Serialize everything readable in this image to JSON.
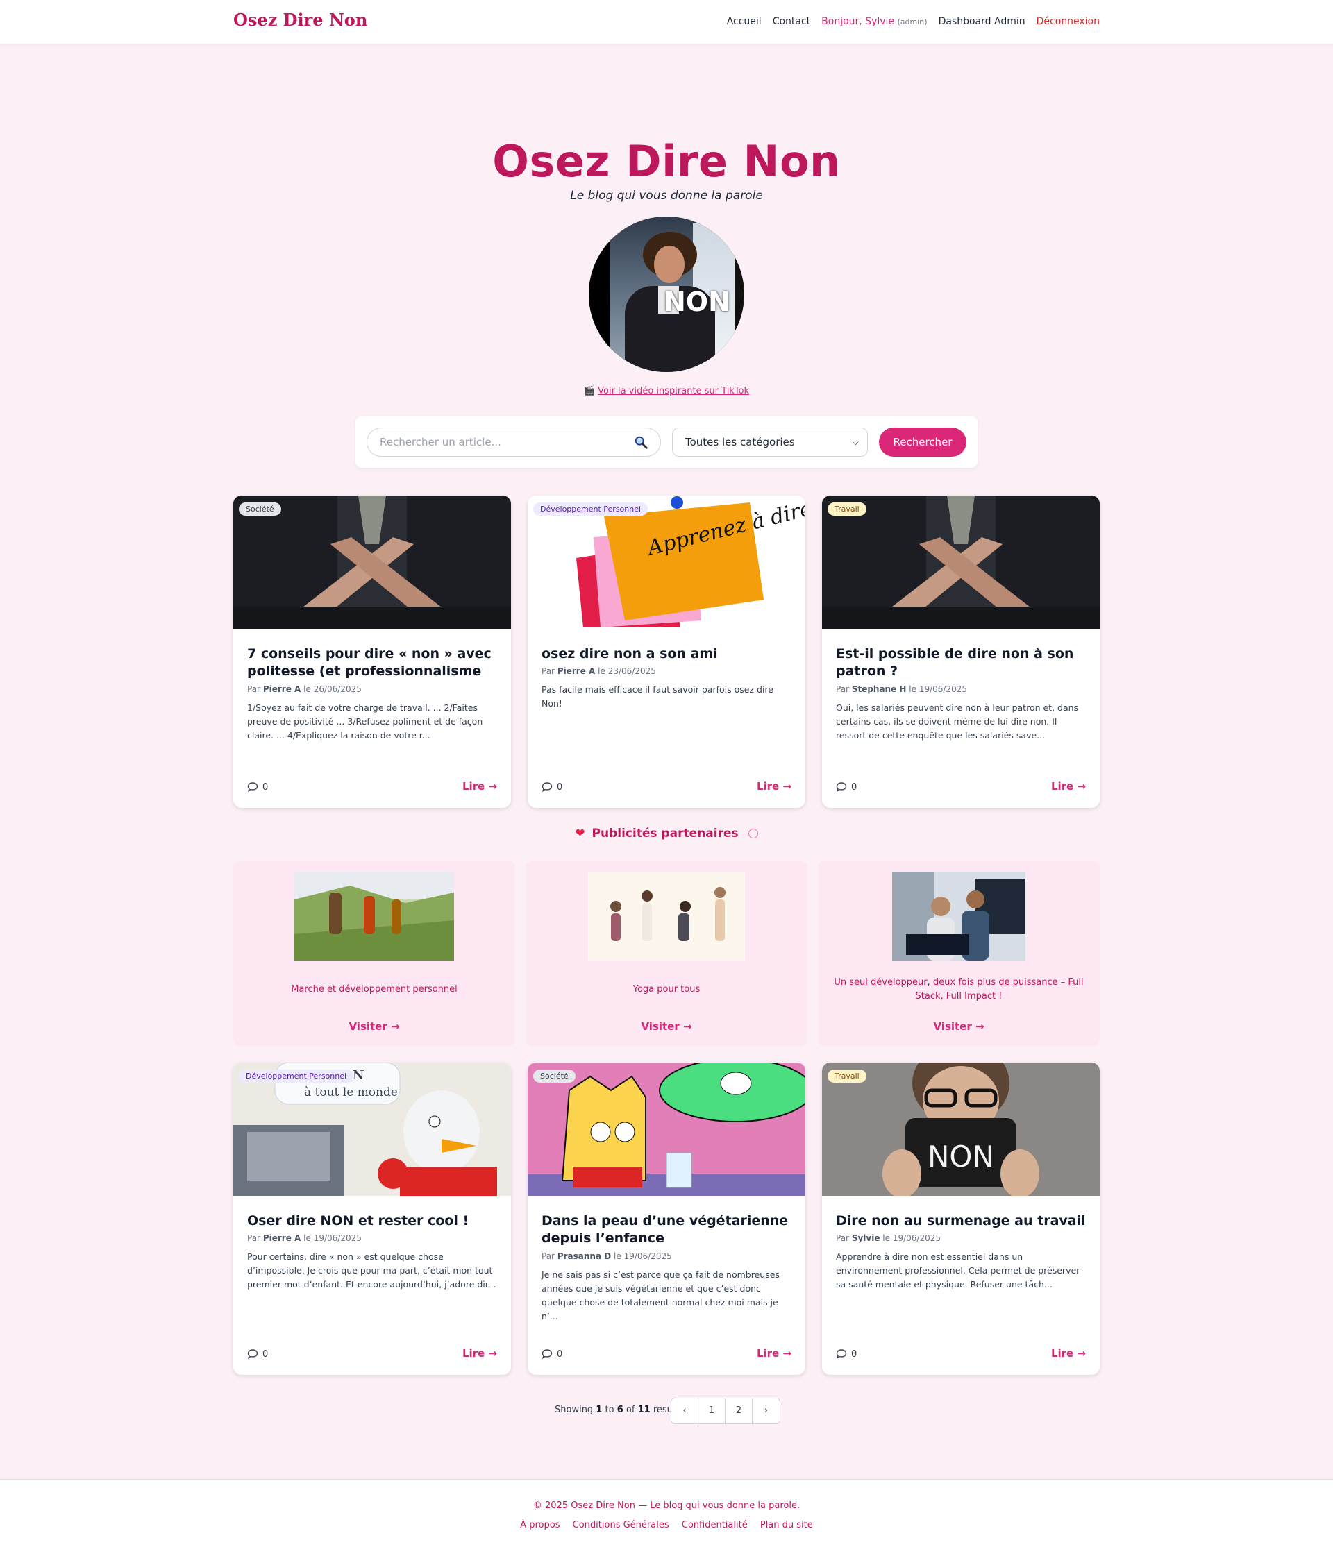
{
  "nav": {
    "brand": "Osez Dire Non",
    "home": "Accueil",
    "contact": "Contact",
    "greeting": "Bonjour, Sylvie",
    "role": "(admin)",
    "dashboard": "Dashboard Admin",
    "logout": "Déconnexion"
  },
  "hero": {
    "title": "Osez Dire Non",
    "subtitle": "Le blog qui vous donne la parole",
    "image_text": "NON",
    "video_link": "Voir la vidéo inspirante sur TikTok"
  },
  "search": {
    "placeholder": "Rechercher un article...",
    "category": "Toutes les catégories",
    "button": "Rechercher"
  },
  "articles": [
    {
      "category": "Société",
      "title": "7 conseils pour dire « non » avec politesse (et professionnalisme",
      "author": "Pierre A",
      "date": "26/06/2025",
      "excerpt": "1/Soyez au fait de votre charge de travail. ... 2/Faites preuve de positivité ... 3/Refusez poliment et de façon claire. ... 4/Expliquez la raison de votre r...",
      "comments": "0",
      "read": "Lire →"
    },
    {
      "category": "Développement Personnel",
      "title": "osez dire non a son ami",
      "author": "Pierre A",
      "date": "23/06/2025",
      "excerpt": "Pas facile mais efficace il faut savoir parfois osez dire Non!",
      "comments": "0",
      "read": "Lire →"
    },
    {
      "category": "Travail",
      "title": "Est-il possible de dire non à son patron ?",
      "author": "Stephane H",
      "date": "19/06/2025",
      "excerpt": "Oui, les salariés peuvent dire non à leur patron et, dans certains cas, ils se doivent même de lui dire non. Il ressort de cette enquête que les salariés save...",
      "comments": "0",
      "read": "Lire →"
    },
    {
      "category": "Développement Personnel",
      "title": "Oser dire NON et rester cool !",
      "author": "Pierre A",
      "date": "19/06/2025",
      "excerpt": "Pour certains, dire « non » est quelque chose d’impossible. Je crois que pour ma part, c’était mon tout premier mot d’enfant. Et encore aujourd’hui, j’adore dir...",
      "comments": "0",
      "read": "Lire →"
    },
    {
      "category": "Société",
      "title": "Dans la peau d’une végétarienne depuis l’enfance",
      "author": "Prasanna D",
      "date": "19/06/2025",
      "excerpt": "Je ne sais pas si c’est parce que ça fait de nombreuses années que je suis végétarienne et que c’est donc quelque chose de totalement normal chez moi mais je n’...",
      "comments": "0",
      "read": "Lire →"
    },
    {
      "category": "Travail",
      "title": "Dire non au surmenage au travail",
      "author": "Sylvie",
      "date": "19/06/2025",
      "excerpt": "Apprendre à dire non est essentiel dans un environnement professionnel. Cela permet de préserver sa santé mentale et physique. Refuser une tâch...",
      "comments": "0",
      "read": "Lire →"
    }
  ],
  "card_text": {
    "by": "Par",
    "on": "le"
  },
  "image_text": {
    "postit": "Apprenez à dire non !",
    "cartoon": "à tout le monde",
    "cartoon_n": "N",
    "sign": "NON"
  },
  "ads": {
    "title": "Publicités partenaires",
    "items": [
      {
        "label": "Marche et développement personnel",
        "visit": "Visiter →"
      },
      {
        "label": "Yoga pour tous",
        "visit": "Visiter →"
      },
      {
        "label": "Un seul développeur, deux fois plus de puissance – Full Stack, Full Impact !",
        "visit": "Visiter →"
      }
    ]
  },
  "pagination": {
    "showing": "Showing",
    "to": "to",
    "of": "of",
    "results": "results",
    "from": "1",
    "until": "6",
    "total": "11",
    "pages": [
      "1",
      "2"
    ]
  },
  "footer": {
    "copyright": "© 2025 Osez Dire Non — Le blog qui vous donne la parole.",
    "links": [
      "À propos",
      "Conditions Générales",
      "Confidentialité",
      "Plan du site"
    ]
  },
  "colors": {
    "accent": "#db2777",
    "brand": "#be185d",
    "background": "#fcf0f6",
    "ad_background": "#fce7f3"
  }
}
